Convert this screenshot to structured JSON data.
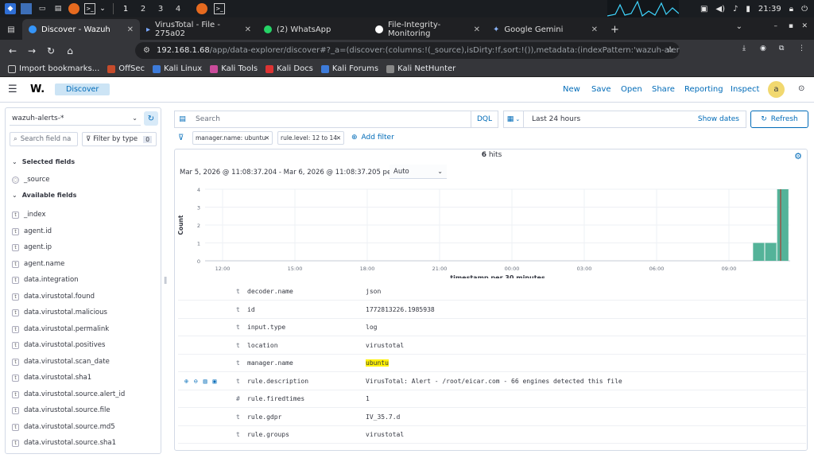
{
  "taskbar": {
    "workspaces": [
      "1",
      "2",
      "3",
      "4"
    ],
    "clock": "21:39"
  },
  "browser": {
    "tabs": [
      {
        "label": "Discover - Wazuh",
        "active": true
      },
      {
        "label": "VirusTotal - File - 275a02",
        "active": false
      },
      {
        "label": "(2) WhatsApp",
        "active": false
      },
      {
        "label": "File-Integrity-Monitoring",
        "active": false
      },
      {
        "label": "Google Gemini",
        "active": false
      }
    ],
    "new_tab": "+",
    "url_host": "192.168.1.68",
    "url_path": "/app/data-explorer/discover#?_a=(discover:(columns:!(_source),isDirty:!f,sort:!()),metadata:(indexPattern:'wazuh-alerts-*',view:dis",
    "bookmarks": [
      "Import bookmarks...",
      "OffSec",
      "Kali Linux",
      "Kali Tools",
      "Kali Docs",
      "Kali Forums",
      "Kali NetHunter"
    ]
  },
  "app": {
    "logo": "W.",
    "breadcrumb": "Discover",
    "menu": [
      "New",
      "Save",
      "Open",
      "Share",
      "Reporting",
      "Inspect"
    ],
    "avatar": "a"
  },
  "sidebar": {
    "index_pattern": "wazuh-alerts-*",
    "search_placeholder": "Search field na",
    "filter_by_type": "Filter by type",
    "filter_count": "0",
    "selected_title": "Selected fields",
    "selected": [
      "_source"
    ],
    "available_title": "Available fields",
    "available": [
      "_index",
      "agent.id",
      "agent.ip",
      "agent.name",
      "data.integration",
      "data.virustotal.found",
      "data.virustotal.malicious",
      "data.virustotal.permalink",
      "data.virustotal.positives",
      "data.virustotal.scan_date",
      "data.virustotal.sha1",
      "data.virustotal.source.alert_id",
      "data.virustotal.source.file",
      "data.virustotal.source.md5",
      "data.virustotal.source.sha1"
    ]
  },
  "query": {
    "placeholder": "Search",
    "language": "DQL",
    "time_range": "Last 24 hours",
    "show_dates": "Show dates",
    "refresh": "Refresh",
    "filters": [
      "manager.name: ubuntu",
      "rule.level: 12 to 14"
    ],
    "add_filter": "Add filter"
  },
  "results": {
    "hits_count": "6",
    "hits_label": "hits",
    "range": "Mar 5, 2026 @ 11:08:37.204 - Mar 6, 2026 @ 11:08:37.205 per",
    "interval": "Auto"
  },
  "chart_data": {
    "type": "bar",
    "ylabel": "Count",
    "xlabel": "timestamp per 30 minutes",
    "y_ticks": [
      "0",
      "1",
      "2",
      "3",
      "4"
    ],
    "ylim": [
      0,
      4
    ],
    "x_ticks": [
      "12:00",
      "15:00",
      "18:00",
      "21:00",
      "00:00",
      "03:00",
      "06:00",
      "09:00"
    ],
    "categories": [
      "10:00",
      "10:30",
      "11:00"
    ],
    "values": [
      1,
      1,
      4
    ],
    "bar_color": "#54b399",
    "grid": true
  },
  "document": {
    "rows": [
      {
        "type": "t",
        "key": "decoder.name",
        "value": "json"
      },
      {
        "type": "t",
        "key": "id",
        "value": "1772813226.1985938"
      },
      {
        "type": "t",
        "key": "input.type",
        "value": "log"
      },
      {
        "type": "t",
        "key": "location",
        "value": "virustotal"
      },
      {
        "type": "t",
        "key": "manager.name",
        "value": "ubuntu"
      },
      {
        "type": "t",
        "key": "rule.description",
        "value": "VirusTotal: Alert - /root/eicar.com - 66 engines detected this file"
      },
      {
        "type": "#",
        "key": "rule.firedtimes",
        "value": "1"
      },
      {
        "type": "t",
        "key": "rule.gdpr",
        "value": "IV_35.7.d"
      },
      {
        "type": "t",
        "key": "rule.groups",
        "value": "virustotal"
      }
    ]
  }
}
